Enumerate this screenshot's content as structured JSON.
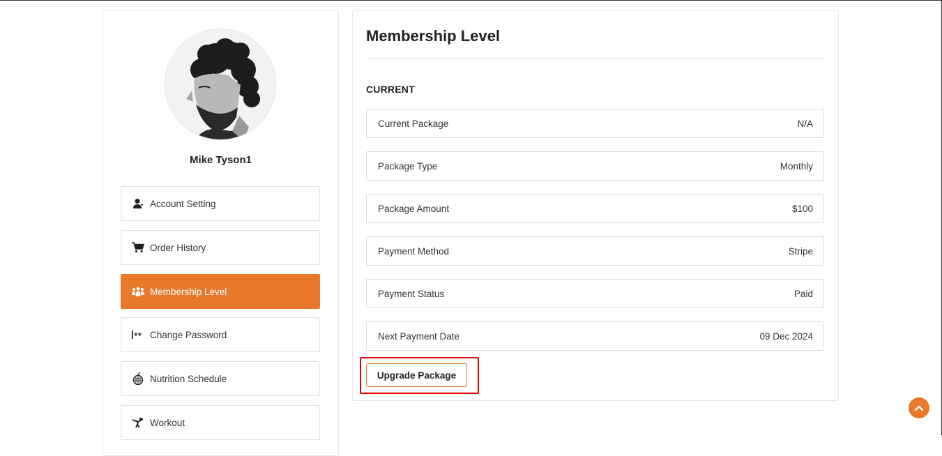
{
  "profile": {
    "name": "Mike Tyson1"
  },
  "nav": {
    "items": [
      {
        "label": "Account Setting",
        "icon": "user-icon",
        "active": false
      },
      {
        "label": "Order History",
        "icon": "cart-icon",
        "active": false
      },
      {
        "label": "Membership Level",
        "icon": "group-icon",
        "active": true
      },
      {
        "label": "Change Password",
        "icon": "password-icon",
        "active": false
      },
      {
        "label": "Nutrition Schedule",
        "icon": "apple-icon",
        "active": false
      },
      {
        "label": "Workout",
        "icon": "workout-icon",
        "active": false
      }
    ]
  },
  "main": {
    "title": "Membership Level",
    "section": "CURRENT",
    "rows": [
      {
        "label": "Current Package",
        "value": "N/A"
      },
      {
        "label": "Package Type",
        "value": "Monthly"
      },
      {
        "label": "Package Amount",
        "value": "$100"
      },
      {
        "label": "Payment Method",
        "value": "Stripe"
      },
      {
        "label": "Payment Status",
        "value": "Paid"
      },
      {
        "label": "Next Payment Date",
        "value": "09 Dec 2024"
      }
    ],
    "upgrade_label": "Upgrade Package"
  },
  "colors": {
    "accent": "#e8792b",
    "highlight": "#e10000"
  }
}
